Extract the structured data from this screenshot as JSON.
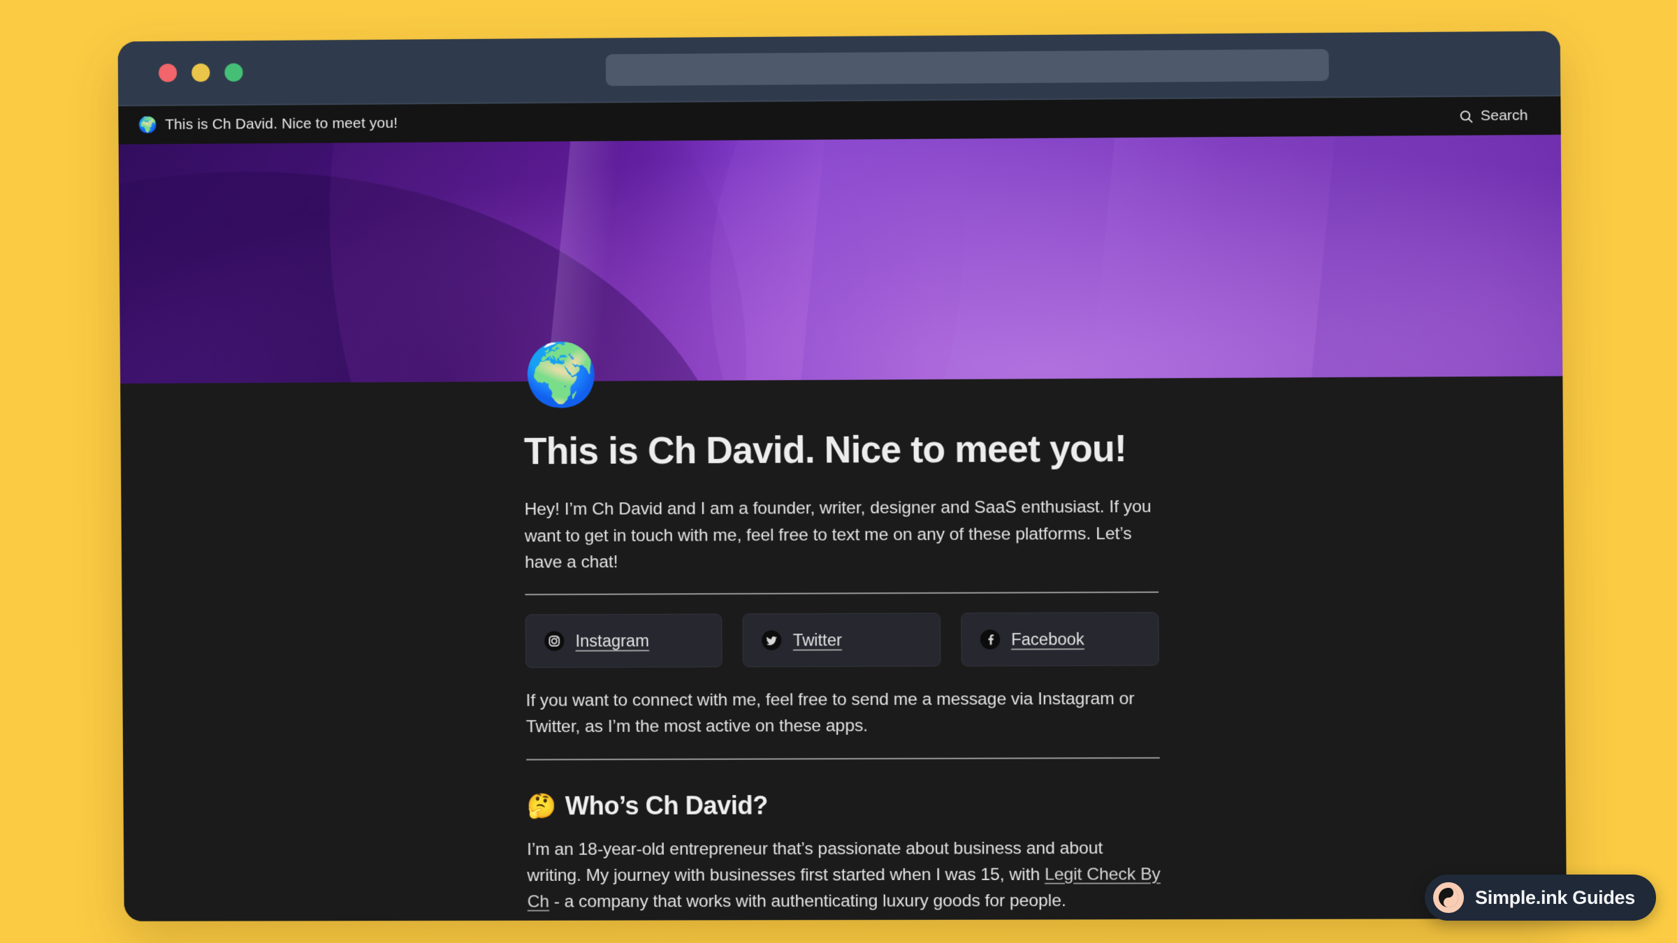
{
  "background": {
    "color": "#FBCB43"
  },
  "browser": {
    "traffic_lights": [
      {
        "name": "close",
        "color": "#F2656A"
      },
      {
        "name": "minimize",
        "color": "#EBC54A"
      },
      {
        "name": "maximize",
        "color": "#45BF75"
      }
    ],
    "url_bar": {
      "value": "",
      "placeholder": ""
    }
  },
  "nav": {
    "favicon": "🌍",
    "title": "This is Ch David. Nice to meet you!",
    "search_label": "Search",
    "search_icon": "search-icon"
  },
  "cover": {
    "alt": "purple-gradient-cover"
  },
  "page": {
    "icon": "🌍",
    "title": "This is Ch David. Nice to meet you!",
    "intro": "Hey! I’m Ch David and I am a founder, writer, designer and SaaS enthusiast. If you want to get in touch with me, feel free to text me on any of these platforms. Let’s have a chat!",
    "social_links": [
      {
        "label": "Instagram",
        "icon": "instagram-icon"
      },
      {
        "label": "Twitter",
        "icon": "twitter-icon"
      },
      {
        "label": "Facebook",
        "icon": "facebook-icon"
      }
    ],
    "connect_text": "If you want to connect with me, feel free to send me a message via Instagram or Twitter, as I’m the most active on these apps.",
    "section": {
      "emoji": "🤔",
      "heading": "Who’s Ch David?",
      "body_before_link": "I’m an 18-year-old entrepreneur that’s passionate about business and about writing. My journey with businesses first started when I was 15, with ",
      "link_text": "Legit Check By Ch",
      "body_after_link": " - a company that works with authenticating luxury goods for people."
    }
  },
  "badge": {
    "label": "Simple.ink Guides",
    "logo": "yin-yang-icon",
    "logo_bg": "#F9CDB4",
    "bg": "#1F2937"
  }
}
